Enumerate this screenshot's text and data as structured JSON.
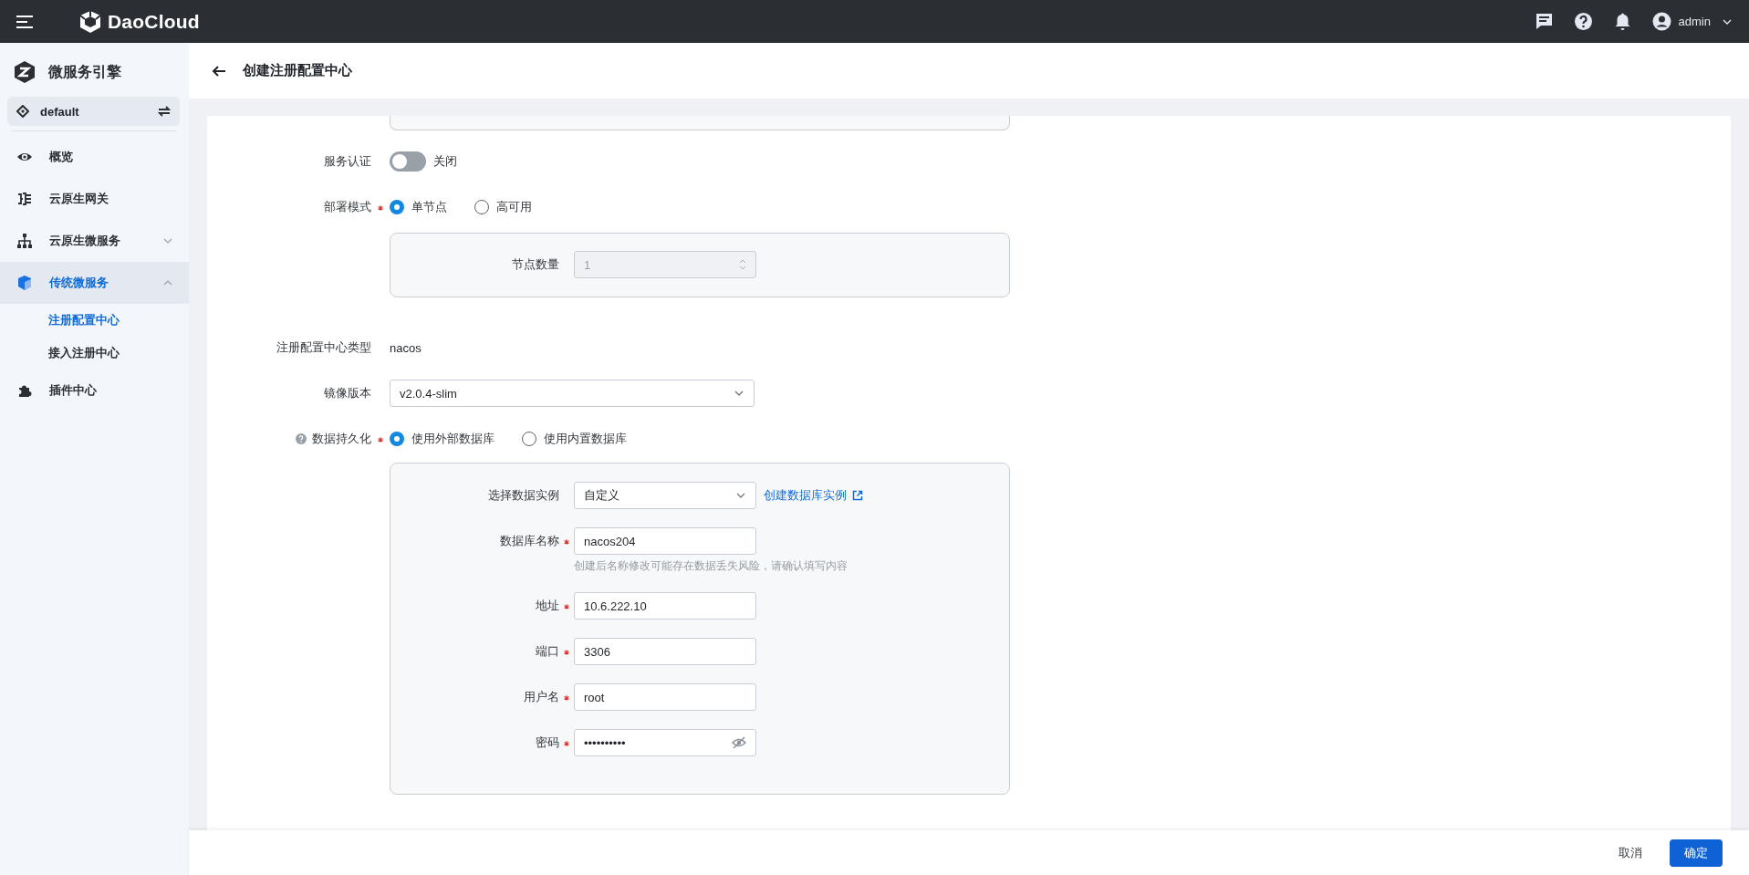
{
  "topbar": {
    "brand": "DaoCloud",
    "user": "admin"
  },
  "sidebar": {
    "module": "微服务引擎",
    "workspace": "default",
    "items": [
      {
        "label": "概览",
        "selected": false
      },
      {
        "label": "云原生网关",
        "selected": false
      },
      {
        "label": "云原生微服务",
        "selected": false,
        "expanded": false
      },
      {
        "label": "传统微服务",
        "selected": true,
        "expanded": true,
        "children": [
          {
            "label": "注册配置中心",
            "selected": true
          },
          {
            "label": "接入注册中心",
            "selected": false
          }
        ]
      },
      {
        "label": "插件中心",
        "selected": false
      }
    ]
  },
  "page": {
    "title": "创建注册配置中心"
  },
  "form": {
    "auth": {
      "label": "服务认证",
      "on": false,
      "state_text": "关闭"
    },
    "deploy": {
      "label": "部署模式",
      "required": true,
      "options": [
        {
          "label": "单节点",
          "selected": true
        },
        {
          "label": "高可用",
          "selected": false
        }
      ],
      "panel": {
        "label": "节点数量",
        "value": "1",
        "disabled": true
      }
    },
    "type": {
      "label": "注册配置中心类型",
      "value": "nacos"
    },
    "image": {
      "label": "镜像版本",
      "value": "v2.0.4-slim"
    },
    "persistence": {
      "label": "数据持久化",
      "required": true,
      "options": [
        {
          "label": "使用外部数据库",
          "selected": true
        },
        {
          "label": "使用内置数据库",
          "selected": false
        }
      ],
      "fields": [
        {
          "kind": "select",
          "label": "选择数据实例",
          "required": false,
          "value": "自定义",
          "link": "创建数据库实例"
        },
        {
          "kind": "input",
          "label": "数据库名称",
          "required": true,
          "value": "nacos204",
          "hint": "创建后名称修改可能存在数据丢失风险，请确认填写内容"
        },
        {
          "kind": "input",
          "label": "地址",
          "required": true,
          "value": "10.6.222.10"
        },
        {
          "kind": "input",
          "label": "端口",
          "required": true,
          "value": "3306"
        },
        {
          "kind": "input",
          "label": "用户名",
          "required": true,
          "value": "root"
        },
        {
          "kind": "password",
          "label": "密码",
          "required": true,
          "value": "••••••••••"
        }
      ]
    }
  },
  "footer": {
    "cancel": "取消",
    "confirm": "确定"
  }
}
